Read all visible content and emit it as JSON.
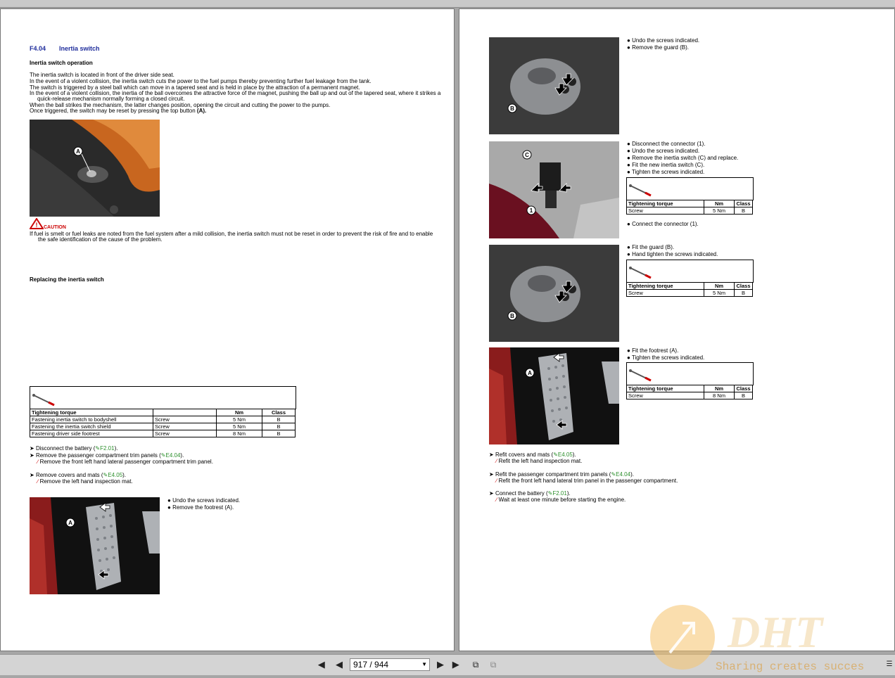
{
  "viewer": {
    "page_indicator": "917 / 944"
  },
  "left": {
    "section_code": "F4.04",
    "section_title": "Inertia switch",
    "op_heading": "Inertia switch operation",
    "op_lines": [
      "The inertia switch is located in front of the driver side seat.",
      "In the event of a violent collision, the inertia switch cuts the power to the fuel pumps thereby preventing further fuel leakage from the tank.",
      "The switch is triggered by a steel ball which can move in a tapered seat and is held in place by the attraction of a permanent magnet.",
      "In the event of a violent collision, the inertia of the ball overcomes the attractive force of the magnet, pushing the ball up and out of the tapered seat, where it strikes a",
      "quick-release mechanism normally forming a closed circuit.",
      "When the ball strikes the mechanism, the latter changes position, opening the circuit and cutting the power to the pumps.",
      "Once triggered, the switch may be reset by pressing the top button"
    ],
    "op_last_ref": "(A).",
    "photo1_label": "A",
    "caution_label": "CAUTION",
    "caution_line1": "If fuel is smelt or fuel leaks are noted from the fuel system after a mild collision, the inertia switch must not be reset in order to prevent the risk of fire and to enable",
    "caution_line2": "the safe identification of the cause of the problem.",
    "replace_heading": "Replacing the inertia switch",
    "torque_table": {
      "headers": [
        "Tightening torque",
        "",
        "Nm",
        "Class"
      ],
      "rows": [
        [
          "Fastening inertia switch to bodyshell",
          "Screw",
          "5 Nm",
          "B"
        ],
        [
          "Fastening the inertia switch shield",
          "Screw",
          "5 Nm",
          "B"
        ],
        [
          "Fastening driver side footrest",
          "Screw",
          "8 Nm",
          "B"
        ]
      ]
    },
    "steps": [
      {
        "text": "Disconnect the battery (",
        "ref": "F2.01",
        "end": ").",
        "sub": ""
      },
      {
        "text": "Remove the passenger compartment trim panels (",
        "ref": "E4.04",
        "end": ").",
        "sub": "Remove the front left hand lateral passenger compartment trim panel."
      },
      {
        "text": "Remove covers and mats (",
        "ref": "E4.05",
        "end": ").",
        "sub": "Remove the left hand inspection mat."
      }
    ],
    "photo2_label": "A",
    "photo2_bullets": [
      "Undo the screws indicated.",
      "Remove the footrest (A)."
    ]
  },
  "right": {
    "block1": {
      "label": "B",
      "bullets": [
        "Undo the screws indicated.",
        "Remove the guard (B)."
      ]
    },
    "block2": {
      "labels": [
        "C",
        "1"
      ],
      "bullets": [
        "Disconnect the connector (1).",
        "Undo the screws indicated.",
        "Remove the inertia switch (C) and replace.",
        "Fit the new inertia switch (C).",
        "Tighten the screws indicated."
      ],
      "torque": {
        "headers": [
          "Tightening torque",
          "Nm",
          "Class"
        ],
        "row": [
          "Screw",
          "5 Nm",
          "B"
        ]
      },
      "after": "Connect the connector (1)."
    },
    "block3": {
      "label": "B",
      "bullets": [
        "Fit the guard (B).",
        "Hand tighten the screws indicated."
      ],
      "torque": {
        "headers": [
          "Tightening torque",
          "Nm",
          "Class"
        ],
        "row": [
          "Screw",
          "5 Nm",
          "B"
        ]
      }
    },
    "block4": {
      "label": "A",
      "bullets": [
        "Fit the footrest (A).",
        "Tighten the screws indicated."
      ],
      "torque": {
        "headers": [
          "Tightening torque",
          "Nm",
          "Class"
        ],
        "row": [
          "Screw",
          "8 Nm",
          "B"
        ]
      }
    },
    "steps": [
      {
        "text": "Refit covers and mats (",
        "ref": "E4.05",
        "end": ").",
        "sub": "Refit the left hand inspection mat."
      },
      {
        "text": "Refit the passenger compartment trim panels (",
        "ref": "E4.04",
        "end": ").",
        "sub": "Refit the front left hand lateral trim panel in the passenger compartment."
      },
      {
        "text": "Connect the battery (",
        "ref": "F2.01",
        "end": ").",
        "sub": "Wait at least one minute before starting the engine."
      }
    ]
  },
  "watermark": {
    "brand": "DHT",
    "slogan": "Sharing creates succes"
  }
}
